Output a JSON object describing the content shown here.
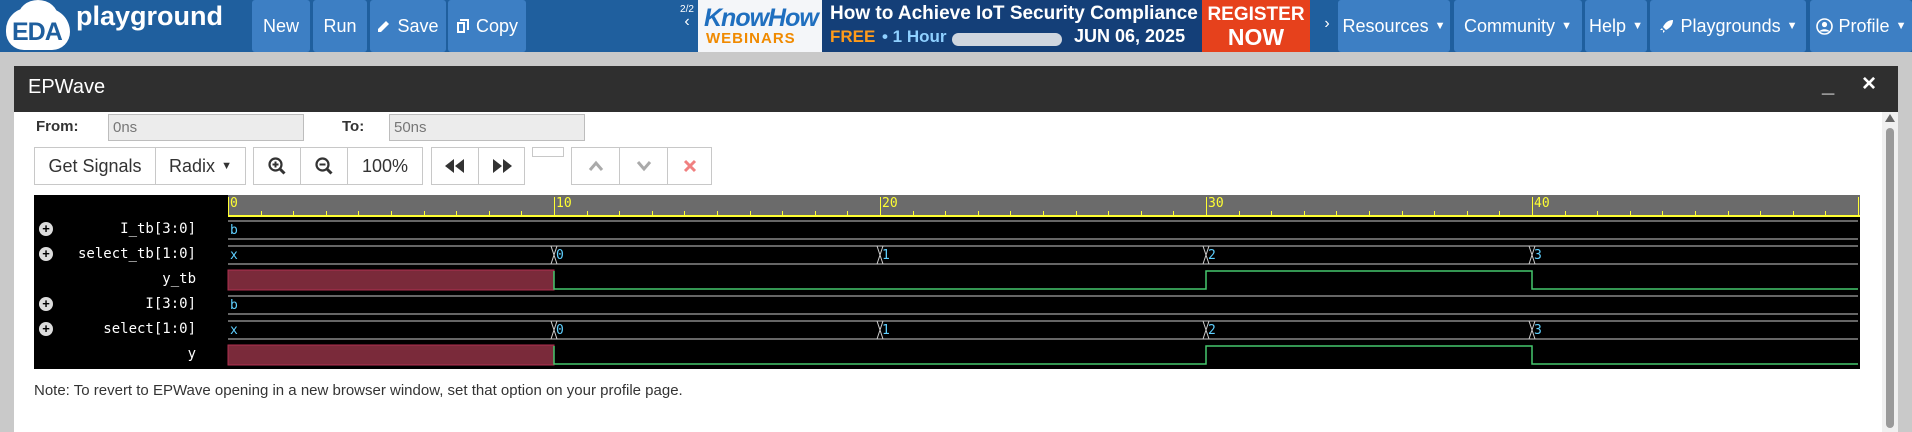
{
  "nav": {
    "logo_eda": "EDA",
    "logo_playground": "playground",
    "new": "New",
    "run": "Run",
    "save": "Save",
    "copy": "Copy",
    "carousel_count": "2/2",
    "resources": "Resources",
    "community": "Community",
    "help": "Help",
    "playgrounds": "Playgrounds",
    "profile": "Profile"
  },
  "ad": {
    "brand": "KnowHow",
    "sub": "WEBINARS",
    "title": "How to Achieve IoT Security Compliance",
    "free": "FREE",
    "hour": "• 1 Hour",
    "date": "JUN 06, 2025",
    "register1": "REGISTER",
    "register2": "NOW"
  },
  "modal": {
    "title": "EPWave",
    "minimize": "_",
    "close": "×",
    "from_label": "From:",
    "from_value": "0ns",
    "to_label": "To:",
    "to_value": "50ns",
    "get_signals": "Get Signals",
    "radix": "Radix",
    "zoom": "100%",
    "note": "Note: To revert to EPWave opening in a new browser window, set that option on your profile page."
  },
  "icons": {
    "save": "pencil-icon",
    "copy": "copy-icon",
    "zoom_in": "zoom-in-icon",
    "zoom_out": "zoom-out-icon",
    "rewind": "rewind-icon",
    "fast_forward": "fast-forward-icon",
    "up": "chevron-up-icon",
    "down": "chevron-down-icon",
    "delete": "x-icon"
  },
  "colors": {
    "nav": "#1f5f9e",
    "nav_button": "#3d7fc4",
    "wave_bg": "#000000",
    "ruler": "#ffff33",
    "signal": "#5fd0ff",
    "high": "#46c86e",
    "undefined": "#7a2a3a"
  },
  "waveform": {
    "time_ticks": [
      "0",
      "10",
      "20",
      "30",
      "40"
    ],
    "signals": [
      {
        "name": "I_tb[3:0]",
        "expandable": true,
        "values": [
          "b"
        ]
      },
      {
        "name": "select_tb[1:0]",
        "expandable": true,
        "values": [
          "x",
          "0",
          "1",
          "2",
          "3"
        ]
      },
      {
        "name": "y_tb",
        "expandable": false,
        "values": []
      },
      {
        "name": "I[3:0]",
        "expandable": true,
        "values": [
          "b"
        ]
      },
      {
        "name": "select[1:0]",
        "expandable": true,
        "values": [
          "x",
          "0",
          "1",
          "2",
          "3"
        ]
      },
      {
        "name": "y",
        "expandable": false,
        "values": []
      }
    ]
  }
}
